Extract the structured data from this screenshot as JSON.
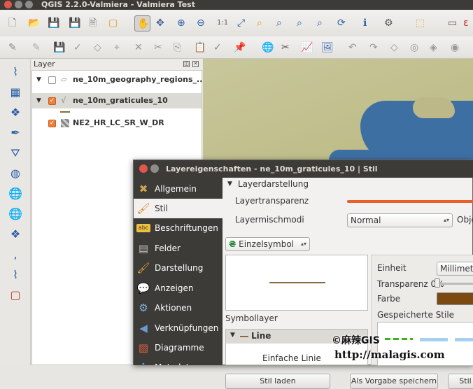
{
  "window": {
    "title": "QGIS 2.2.0-Valmiera - Valmiera Test"
  },
  "icons": {
    "toolbar1": [
      "new-project-icon",
      "open-project-icon",
      "save-project-icon",
      "save-as-icon",
      "print-composer-icon",
      "composer-manager-icon",
      "pan-icon",
      "pan-to-selection-icon",
      "zoom-in-icon",
      "zoom-out-icon",
      "zoom-actual-icon",
      "zoom-full-icon",
      "zoom-to-selection-icon",
      "zoom-to-layer-icon",
      "zoom-last-icon",
      "zoom-next-icon",
      "refresh-icon",
      "identify-icon",
      "action-icon",
      "select-icon",
      "measure-icon"
    ],
    "toolbar2": [
      "digitize-icon",
      "edit-icon",
      "save-edits-icon",
      "add-feature-icon",
      "move-feature-icon",
      "node-tool-icon",
      "delete-selected-icon",
      "cut-icon",
      "copy-icon",
      "paste-icon",
      "label-icon",
      "pin-icon",
      "globe-icon",
      "gps-icon",
      "raster-icon",
      "image-icon",
      "undo-icon",
      "redo-icon",
      "simplify-icon",
      "ring-icon",
      "part-icon",
      "fill-ring-icon"
    ],
    "left": [
      "add-vector-layer-icon",
      "add-raster-layer-icon",
      "add-postgis-icon",
      "add-spatialite-icon",
      "add-mssql-icon",
      "add-oracle-icon",
      "add-wms-icon",
      "add-wcs-icon",
      "add-wfs-icon",
      "add-delimited-text-icon",
      "new-shapefile-icon",
      "remove-layer-icon"
    ]
  },
  "layer_panel": {
    "title": "Layer",
    "layers": [
      {
        "name": "ne_10m_geography_regions_...",
        "checked": false
      },
      {
        "name": "ne_10m_graticules_10",
        "checked": true
      },
      {
        "name": "NE2_HR_LC_SR_W_DR",
        "checked": true
      }
    ]
  },
  "dialog": {
    "title": "Layereigenschaften - ne_10m_graticules_10 | Stil",
    "sidebar": [
      "Allgemein",
      "Stil",
      "Beschriftungen",
      "Felder",
      "Darstellung",
      "Anzeigen",
      "Aktionen",
      "Verknüpfungen",
      "Diagramme",
      "Metadaten"
    ],
    "active_index": 1,
    "section": "Layerdarstellung",
    "transparency_label": "Layertransparenz",
    "blend_label": "Layermischmodi",
    "blend_value": "Normal",
    "object_label": "Obje",
    "renderer": "Einzelsymbol",
    "symbol_layer_label": "Symbollayer",
    "symbol_tree": [
      "Line",
      "Einfache Linie"
    ],
    "unit_label": "Einheit",
    "unit_value": "Millimete",
    "transp_label": "Transparenz 0%",
    "color_label": "Farbe",
    "saved_styles_label": "Gespeicherte Stile",
    "buttons": [
      "Stil laden",
      "Als Vorgabe speichern",
      "Stil"
    ]
  },
  "watermark": {
    "line1": "©麻辣GIS",
    "line2": "http://malagis.com"
  },
  "colors": {
    "line": "#8a6a3f",
    "slider": "#e8602c",
    "swatch": "#7a4a12",
    "accent": "#ef7f3a"
  }
}
